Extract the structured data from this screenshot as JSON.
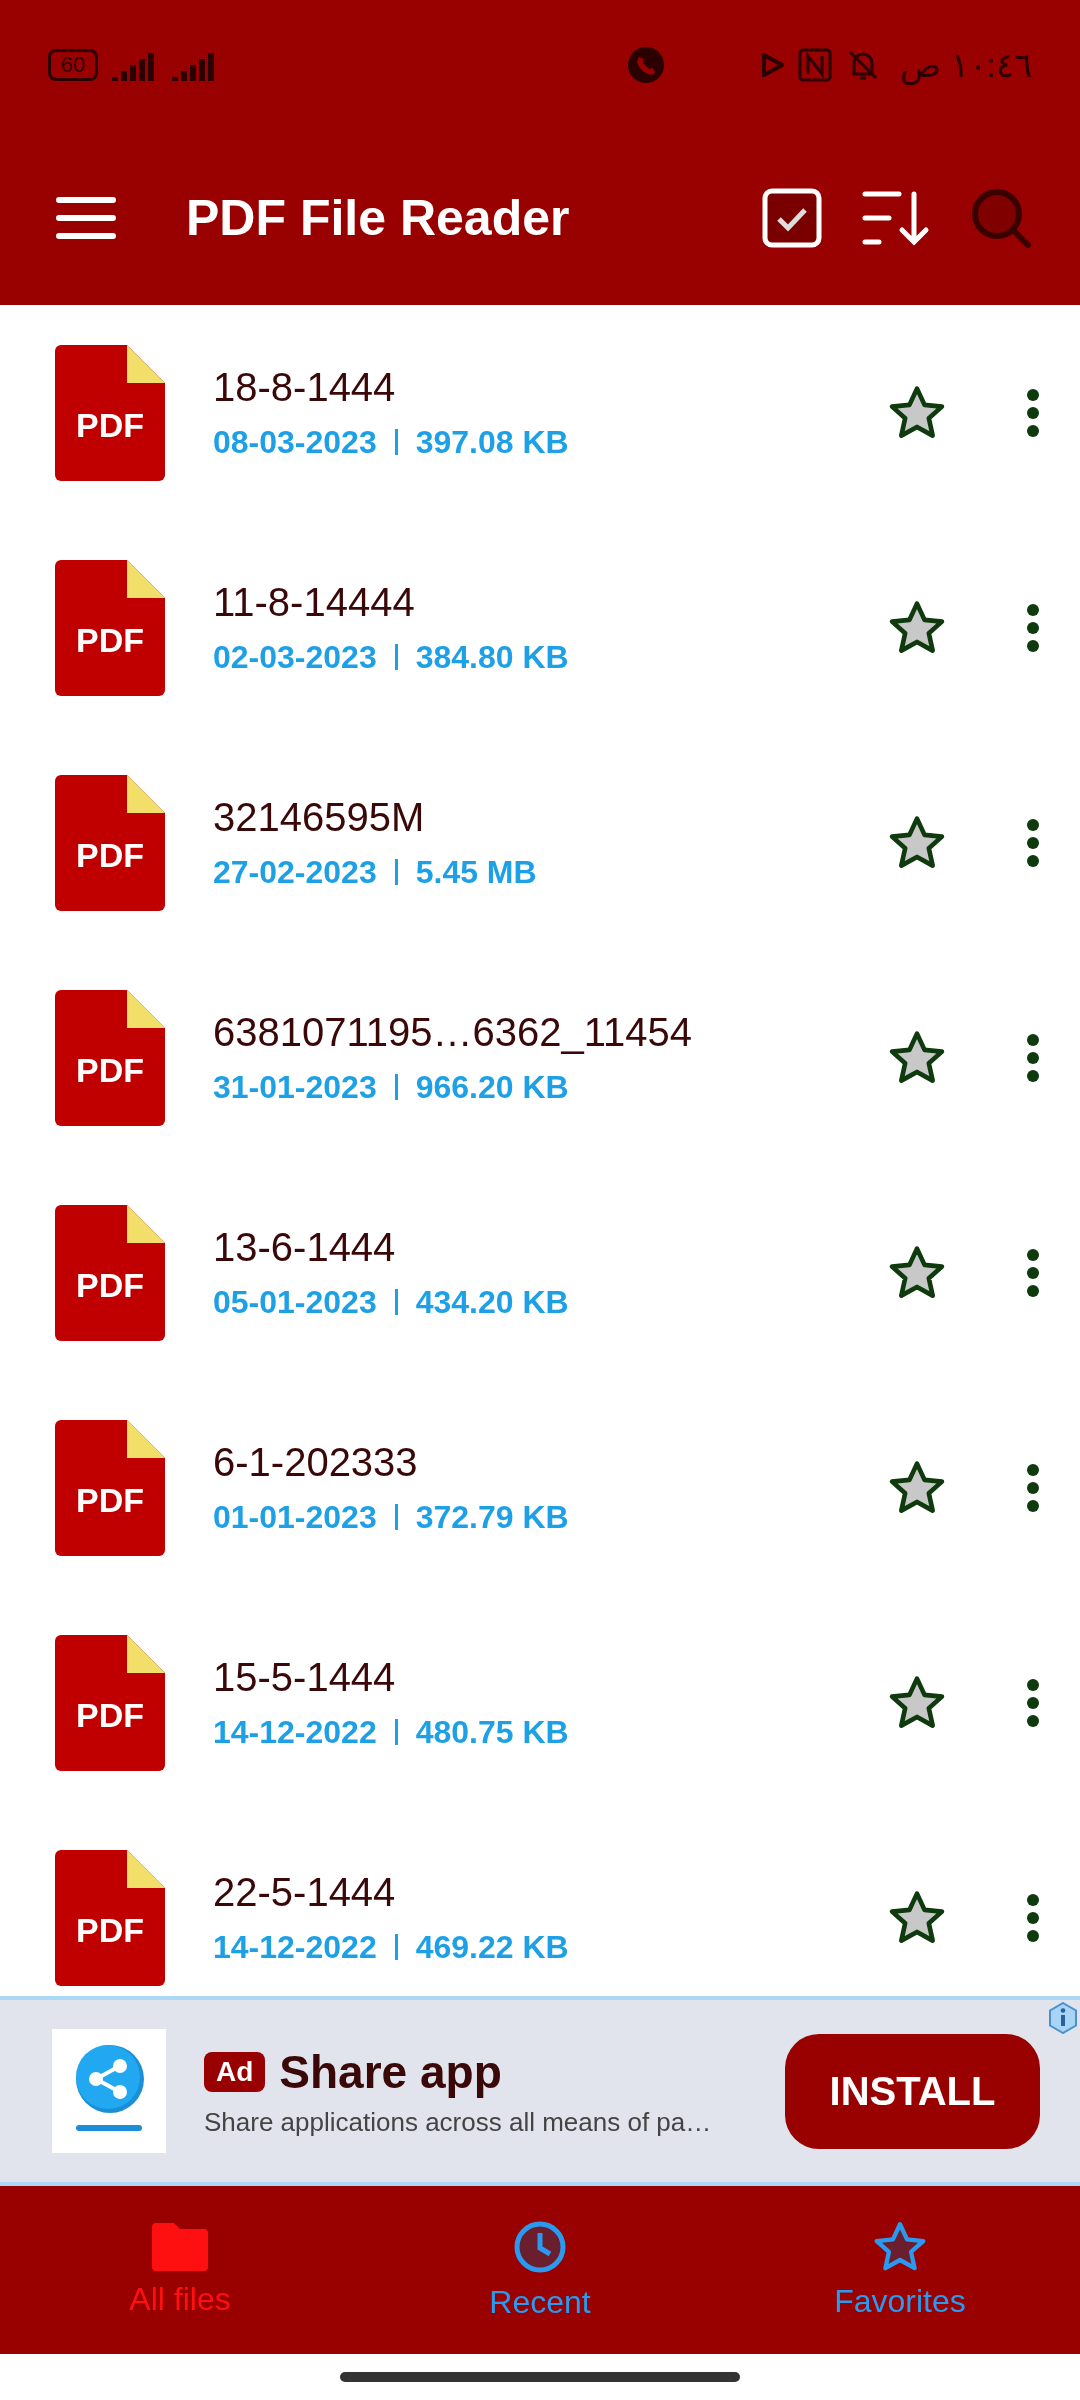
{
  "status_bar": {
    "battery": "60",
    "time": "١٠:٤٦ ص"
  },
  "app_bar": {
    "title": "PDF File Reader"
  },
  "files": [
    {
      "badge": "PDF",
      "name": "18-8-1444",
      "date": "08-03-2023",
      "size": "397.08 KB",
      "favorite": false
    },
    {
      "badge": "PDF",
      "name": "11-8-14444",
      "date": "02-03-2023",
      "size": "384.80 KB",
      "favorite": false
    },
    {
      "badge": "PDF",
      "name": "32146595M",
      "date": "27-02-2023",
      "size": "5.45 MB",
      "favorite": false
    },
    {
      "badge": "PDF",
      "name": "6381071195…6362_11454",
      "date": "31-01-2023",
      "size": "966.20 KB",
      "favorite": false
    },
    {
      "badge": "PDF",
      "name": "13-6-1444",
      "date": "05-01-2023",
      "size": "434.20 KB",
      "favorite": false
    },
    {
      "badge": "PDF",
      "name": "6-1-202333",
      "date": "01-01-2023",
      "size": "372.79 KB",
      "favorite": false
    },
    {
      "badge": "PDF",
      "name": "15-5-1444",
      "date": "14-12-2022",
      "size": "480.75 KB",
      "favorite": false
    },
    {
      "badge": "PDF",
      "name": "22-5-1444",
      "date": "14-12-2022",
      "size": "469.22 KB",
      "favorite": false
    }
  ],
  "ad": {
    "badge": "Ad",
    "title": "Share app",
    "description": "Share applications across all means of pa…",
    "button": "INSTALL"
  },
  "bottom_nav": [
    {
      "kind": "folder",
      "label": "All files",
      "selected": true
    },
    {
      "kind": "clock",
      "label": "Recent",
      "selected": false
    },
    {
      "kind": "star",
      "label": "Favorites",
      "selected": false
    }
  ]
}
